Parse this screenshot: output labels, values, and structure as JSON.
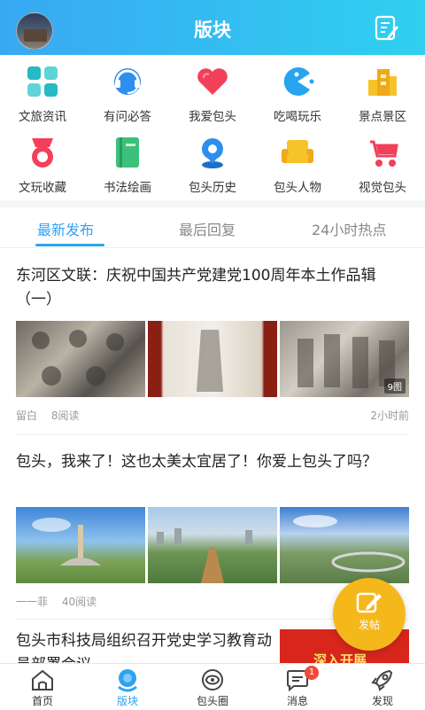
{
  "header": {
    "title": "版块"
  },
  "categories": [
    {
      "label": "文旅资讯",
      "icon": "grid-icon"
    },
    {
      "label": "有问必答",
      "icon": "headset-icon"
    },
    {
      "label": "我爱包头",
      "icon": "heart-icon"
    },
    {
      "label": "吃喝玩乐",
      "icon": "pacman-icon"
    },
    {
      "label": "景点景区",
      "icon": "building-icon"
    },
    {
      "label": "文玩收藏",
      "icon": "medal-icon"
    },
    {
      "label": "书法绘画",
      "icon": "book-icon"
    },
    {
      "label": "包头历史",
      "icon": "location-icon"
    },
    {
      "label": "包头人物",
      "icon": "sofa-icon"
    },
    {
      "label": "视觉包头",
      "icon": "stroller-icon"
    }
  ],
  "tabs": [
    "最新发布",
    "最后回复",
    "24小时热点"
  ],
  "posts": [
    {
      "title": "东河区文联：庆祝中国共产党建党100周年本土作品辑（一）",
      "author": "留白",
      "reads": "8阅读",
      "time": "2小时前",
      "image_count": "9图"
    },
    {
      "title": "包头，我来了！这也太美太宜居了！你爱上包头了吗？",
      "author": "一一菲",
      "reads": "40阅读",
      "time": ""
    },
    {
      "title": "包头市科技局组织召开党史学习教育动员部署会议",
      "banner": "深入开展"
    }
  ],
  "fab": {
    "label": "发帖"
  },
  "bottom_nav": [
    {
      "label": "首页",
      "icon": "home-icon"
    },
    {
      "label": "版块",
      "icon": "blocks-icon",
      "active": true
    },
    {
      "label": "包头圈",
      "icon": "eye-icon"
    },
    {
      "label": "消息",
      "icon": "message-icon",
      "badge": "1"
    },
    {
      "label": "发现",
      "icon": "rocket-icon"
    }
  ],
  "colors": {
    "accent": "#2ea3f2",
    "header_start": "#39a8f3",
    "header_end": "#2fd0ef",
    "fab": "#f5b81b",
    "badge": "#f04a3a"
  }
}
